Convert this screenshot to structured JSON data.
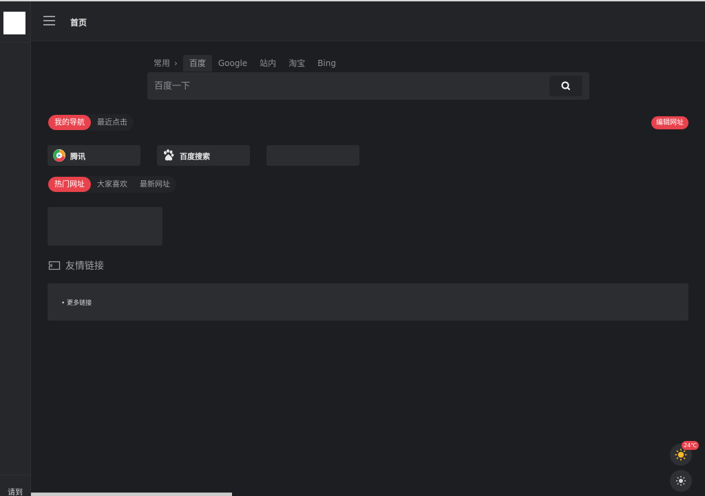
{
  "header": {
    "title": "首页"
  },
  "search": {
    "group": "常用",
    "tabs": [
      "百度",
      "Google",
      "站内",
      "淘宝",
      "Bing"
    ],
    "active_tab": "百度",
    "placeholder": "百度一下"
  },
  "nav_tabs": {
    "mine": "我的导航",
    "recent": "最近点击"
  },
  "edit_label": "编辑网址",
  "my_sites": [
    {
      "name": "腾讯",
      "icon": "tencent-video-icon"
    },
    {
      "name": "百度搜索",
      "icon": "baidu-icon"
    },
    {
      "name": "",
      "icon": ""
    }
  ],
  "hot_tabs": {
    "hot": "热门网址",
    "liked": "大家喜欢",
    "latest": "最新网址"
  },
  "friend_links": {
    "title": "友情链接",
    "more": "更多链接"
  },
  "weather": {
    "temp": "24℃"
  },
  "sidebar": {
    "bottom_text": "请到"
  },
  "colors": {
    "accent": "#e8424c",
    "background": "#1d1e21",
    "card": "#2c2d31"
  }
}
